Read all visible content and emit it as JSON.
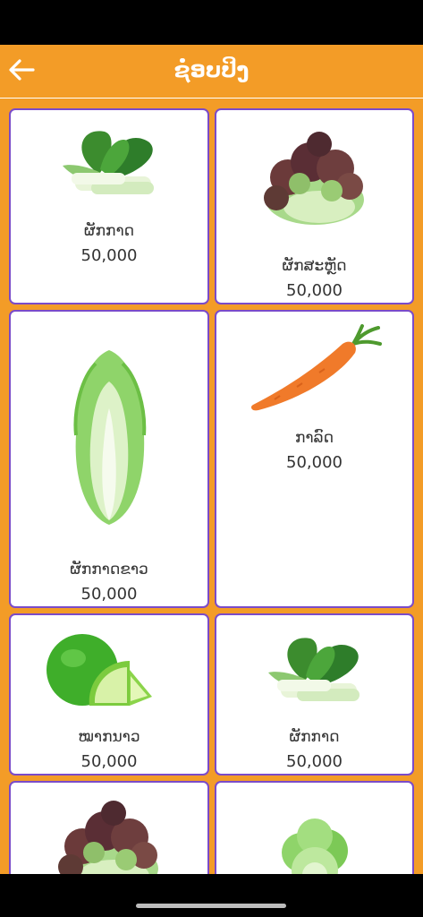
{
  "header": {
    "title": "ຊໍ່ອບປິງ"
  },
  "products": [
    {
      "name": "ຜັກກາດ",
      "price": "50,000",
      "image": "bok-choy"
    },
    {
      "name": "ຜັກສະຫຼັດ",
      "price": "50,000",
      "image": "red-leaf-lettuce"
    },
    {
      "name": "ຜັກກາດຂາວ",
      "price": "50,000",
      "image": "napa-cabbage"
    },
    {
      "name": "ກາລົດ",
      "price": "50,000",
      "image": "carrot"
    },
    {
      "name": "ໝາກນາວ",
      "price": "50,000",
      "image": "lime"
    },
    {
      "name": "ຜັກກາດ",
      "price": "50,000",
      "image": "bok-choy"
    },
    {
      "image": "red-leaf-lettuce"
    },
    {
      "image": "green-lettuce"
    }
  ],
  "colors": {
    "app_bar": "#F39C27",
    "card_border": "#7A4BC9",
    "background": "#F39C27"
  }
}
